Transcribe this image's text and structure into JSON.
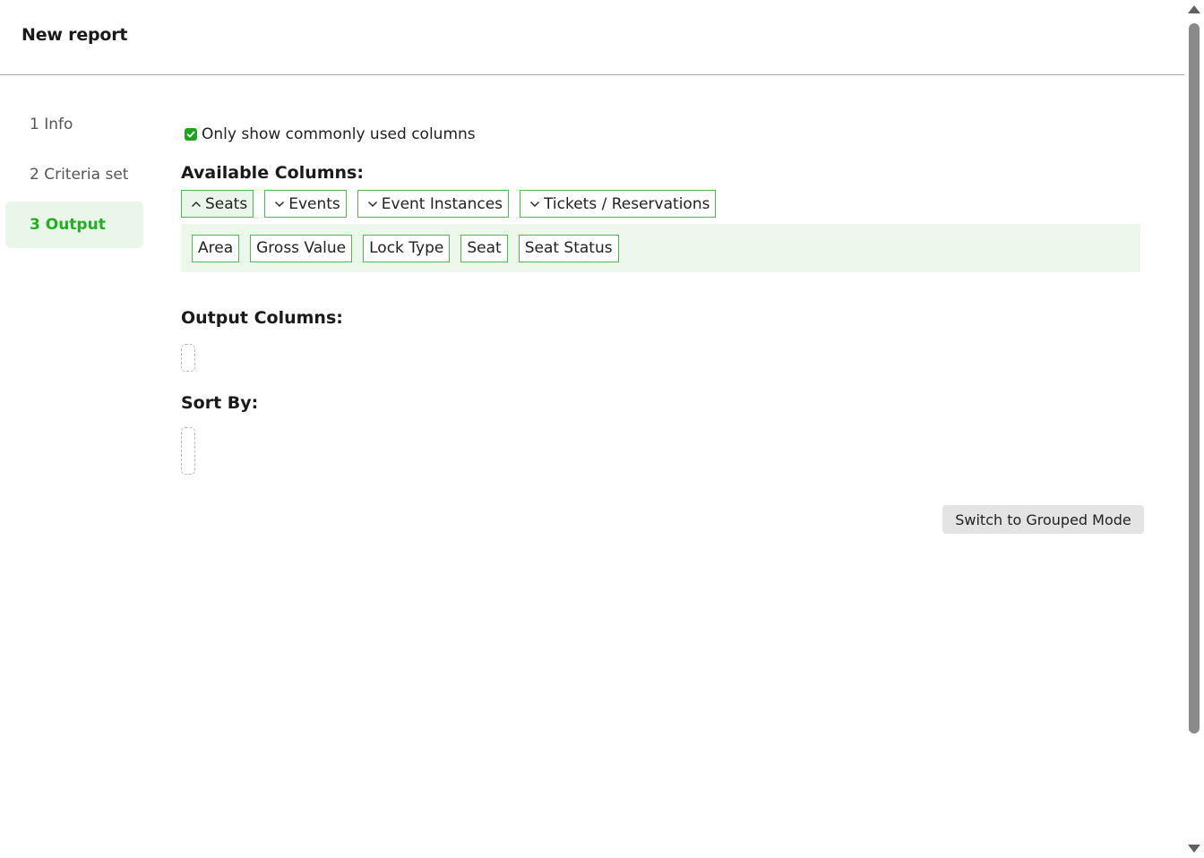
{
  "header": {
    "title": "New report"
  },
  "steps": [
    {
      "label": "1 Info",
      "active": false
    },
    {
      "label": "2 Criteria set",
      "active": false
    },
    {
      "label": "3 Output",
      "active": true
    }
  ],
  "options": {
    "common_columns_label": "Only show commonly used columns",
    "common_columns_checked": true
  },
  "available": {
    "title": "Available Columns:",
    "groups": [
      {
        "label": "Seats",
        "expanded": true,
        "icon": "chevron-up-icon"
      },
      {
        "label": "Events",
        "expanded": false,
        "icon": "chevron-down-icon"
      },
      {
        "label": "Event Instances",
        "expanded": false,
        "icon": "chevron-down-icon"
      },
      {
        "label": "Tickets / Reservations",
        "expanded": false,
        "icon": "chevron-down-icon"
      }
    ],
    "fields": [
      "Area",
      "Gross Value",
      "Lock Type",
      "Seat",
      "Seat Status"
    ]
  },
  "output": {
    "title": "Output Columns:"
  },
  "sort": {
    "title": "Sort By:"
  },
  "actions": {
    "grouped_mode_label": "Switch to Grouped Mode"
  },
  "colors": {
    "accent": "#21b021",
    "accent_border": "#4fb84f",
    "panel_bg": "#edf7ec",
    "active_step_bg": "#e9f6e9"
  }
}
